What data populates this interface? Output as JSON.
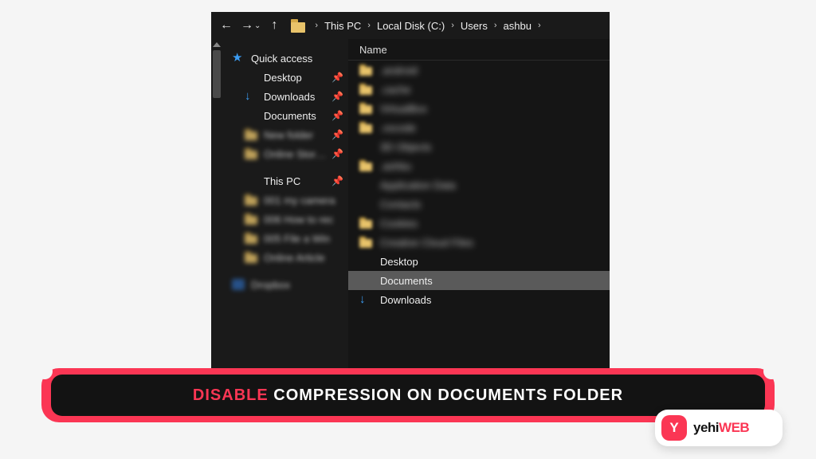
{
  "breadcrumb": {
    "items": [
      "This PC",
      "Local Disk (C:)",
      "Users",
      "ashbu"
    ]
  },
  "column_header": "Name",
  "sidebar": {
    "quick_access": "Quick access",
    "desktop": "Desktop",
    "downloads": "Downloads",
    "documents": "Documents",
    "blur1": "New folder",
    "blur2": "Online Stored F",
    "this_pc": "This PC",
    "blur3": "001 my camera",
    "blur4": "006 How to rec",
    "blur5": "005 File a Win",
    "blur6": "Online Article"
  },
  "files": {
    "b1": ".android",
    "b2": ".cache",
    "b3": "VirtualBox",
    "b4": ".vscode",
    "b5": "3D Objects",
    "b6": ".ashbu",
    "b7": "Application Data",
    "b8": "Contacts",
    "b9": "Cookies",
    "b10": "Creative Cloud Files",
    "desktop": "Desktop",
    "documents": "Documents",
    "downloads": "Downloads"
  },
  "banner": {
    "highlight": "Disable",
    "rest": " compression on documents folder"
  },
  "brand": {
    "glyph": "Y",
    "name_a": "yehi",
    "name_b": "WEB"
  }
}
